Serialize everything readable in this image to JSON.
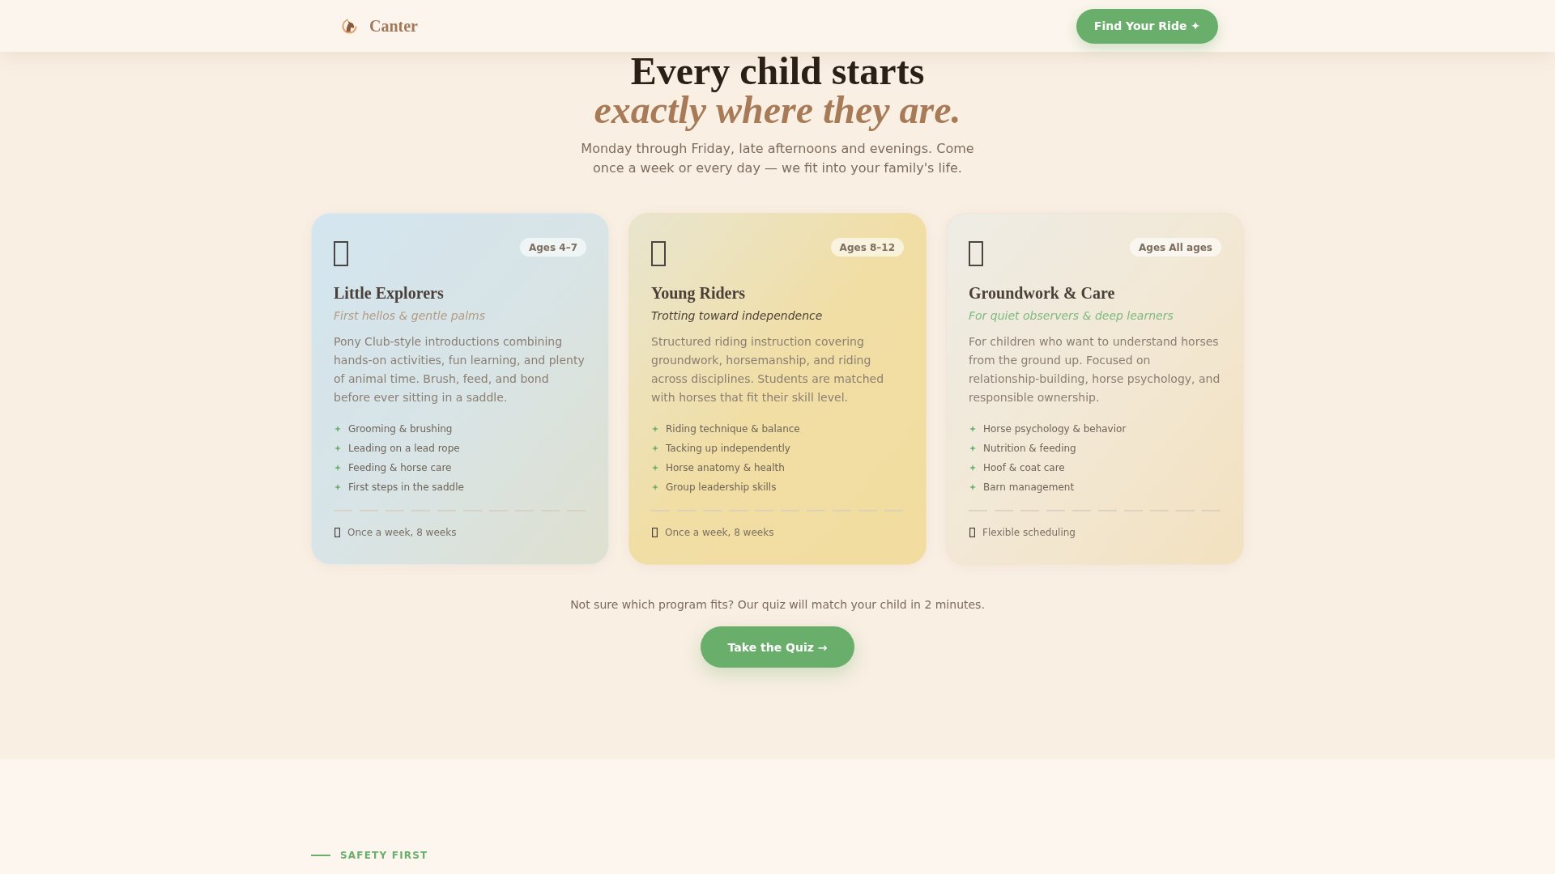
{
  "header": {
    "brand": "Canter",
    "cta": "Find Your Ride ✦"
  },
  "hero": {
    "title_line_1": "Every child starts",
    "title_line_2": "exactly where they are.",
    "subtitle": "Monday through Friday, late afternoons and evenings. Come once a week or every day — we fit into your family's life."
  },
  "programs": [
    {
      "kind": "sky",
      "badge": "Ages 4–7",
      "title": "Little Explorers",
      "tagline": "First hellos & gentle palms",
      "description": "Pony Club-style introductions combining hands-on activities, fun learning, and plenty of animal time. Brush, feed, and bond before ever sitting in a saddle.",
      "features": [
        "Grooming & brushing",
        "Leading on a lead rope",
        "Feeding & horse care",
        "First steps in the saddle"
      ],
      "schedule": "Once a week, 8 weeks"
    },
    {
      "kind": "wheat",
      "badge": "Ages 8–12",
      "title": "Young Riders",
      "tagline": "Trotting toward independence",
      "description": "Structured riding instruction covering groundwork, horsemanship, and riding across disciplines. Students are matched with horses that fit their skill level.",
      "features": [
        "Riding technique & balance",
        "Tacking up independently",
        "Horse anatomy & health",
        "Group leadership skills"
      ],
      "schedule": "Once a week, 8 weeks"
    },
    {
      "kind": "sand",
      "badge": "Ages All ages",
      "title": "Groundwork & Care",
      "tagline": "For quiet observers & deep learners",
      "description": "For children who want to understand horses from the ground up. Focused on relationship-building, horse psychology, and responsible ownership.",
      "features": [
        "Horse psychology & behavior",
        "Nutrition & feeding",
        "Hoof & coat care",
        "Barn management"
      ],
      "schedule": "Flexible scheduling"
    }
  ],
  "quiz": {
    "prompt": "Not sure which program fits? Our quiz will match your child in 2 minutes.",
    "button": "Take the Quiz →"
  },
  "next_section": {
    "eyebrow": "SAFETY FIRST"
  }
}
